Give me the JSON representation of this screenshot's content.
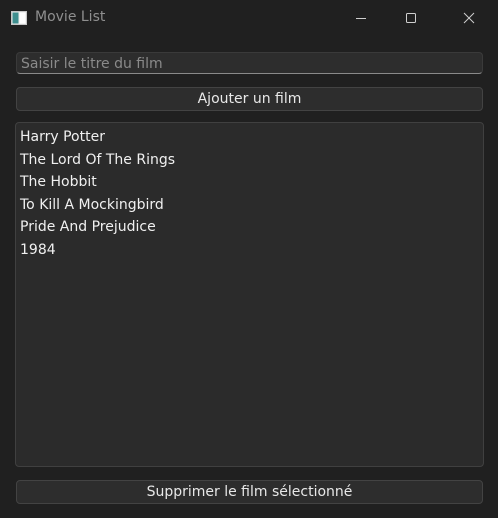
{
  "window": {
    "title": "Movie List"
  },
  "form": {
    "title_placeholder": "Saisir le titre du film",
    "add_button_label": "Ajouter un film"
  },
  "movies": [
    "Harry Potter",
    "The Lord Of The Rings",
    "The Hobbit",
    "To Kill A Mockingbird",
    "Pride And Prejudice",
    "1984"
  ],
  "actions": {
    "remove_button_label": "Supprimer le film sélectionné"
  },
  "icons": {
    "app": "app-window-icon",
    "minimize": "minimize-icon",
    "maximize": "maximize-icon",
    "close": "close-icon"
  },
  "colors": {
    "background": "#202020",
    "surface": "#2d2d2d",
    "list_background": "#2b2b2b",
    "text": "#f0f0f0",
    "muted_text": "#8a8a8a"
  }
}
